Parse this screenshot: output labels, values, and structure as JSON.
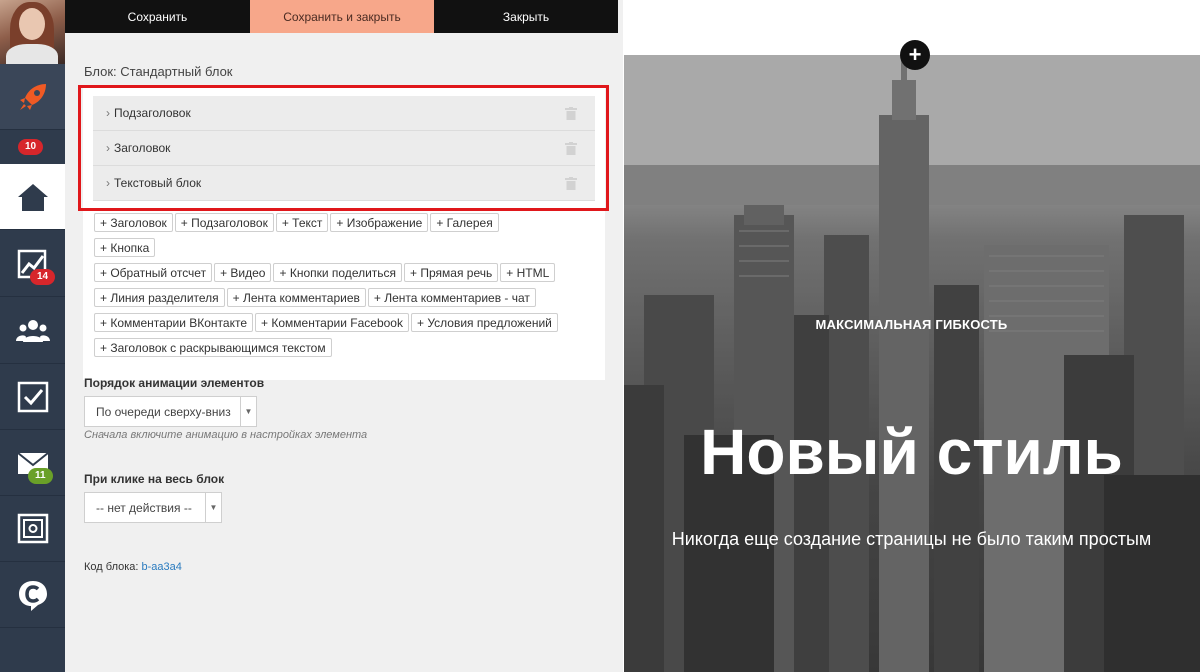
{
  "sidebar": {
    "badges": {
      "rocket": "10",
      "stats": "14",
      "mail": "11"
    }
  },
  "toolbar": {
    "save_label": "Сохранить",
    "save_close_label": "Сохранить и закрыть",
    "close_label": "Закрыть"
  },
  "editor": {
    "block_title": "Блок: Стандартный блок",
    "elements": [
      "Подзаголовок",
      "Заголовок",
      "Текстовый блок"
    ],
    "add_tags": [
      "+ Заголовок",
      "+ Подзаголовок",
      "+ Текст",
      "+ Изображение",
      "+ Галерея",
      "+ Кнопка",
      "+ Обратный отсчет",
      "+ Видео",
      "+ Кнопки поделиться",
      "+ Прямая речь",
      "+ HTML",
      "+ Линия разделителя",
      "+ Лента комментариев",
      "+ Лента комментариев - чат",
      "+ Комментарии ВКонтакте",
      "+ Комментарии Facebook",
      "+ Условия предложений",
      "+ Заголовок с раскрывающимся текстом"
    ],
    "animation_label": "Порядок анимации элементов",
    "animation_value": "По очереди сверху-вниз",
    "animation_hint": "Сначала включите анимацию в настройках элемента",
    "click_label": "При клике на весь блок",
    "click_value": "-- нет действия --",
    "code_label": "Код блока:",
    "code_value": "b-aa3a4"
  },
  "preview": {
    "eyebrow": "МАКСИМАЛЬНАЯ ГИБКОСТЬ",
    "hero": "Новый стиль",
    "subtitle": "Никогда еще создание страницы не было таким простым"
  },
  "colors": {
    "sidebar": "#2f3b4c",
    "accent_button": "#f7a78a",
    "highlight": "#e0171b",
    "rocket": "#f05a24",
    "link": "#2a7bbf"
  }
}
